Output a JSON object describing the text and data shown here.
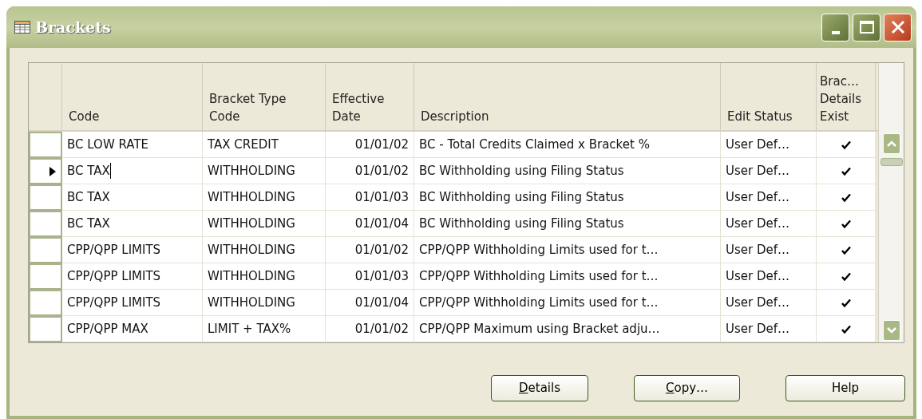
{
  "window": {
    "title": "Brackets"
  },
  "table": {
    "columns": [
      "Code",
      "Bracket Type Code",
      "Effective Date",
      "Description",
      "Edit Status",
      "Brac… Details Exist"
    ],
    "rows": [
      {
        "code": "BC LOW RATE",
        "bracket_type_code": "TAX CREDIT",
        "effective_date": "01/01/02",
        "description": "BC - Total Credits Claimed x Bracket %",
        "edit_status": "User Def…",
        "details_exist": true,
        "selected": false
      },
      {
        "code": "BC TAX",
        "bracket_type_code": "WITHHOLDING",
        "effective_date": "01/01/02",
        "description": "BC Withholding using Filing Status",
        "edit_status": "User Def…",
        "details_exist": true,
        "selected": true
      },
      {
        "code": "BC TAX",
        "bracket_type_code": "WITHHOLDING",
        "effective_date": "01/01/03",
        "description": "BC Withholding using Filing Status",
        "edit_status": "User Def…",
        "details_exist": true,
        "selected": false
      },
      {
        "code": "BC TAX",
        "bracket_type_code": "WITHHOLDING",
        "effective_date": "01/01/04",
        "description": "BC Withholding using Filing Status",
        "edit_status": "User Def…",
        "details_exist": true,
        "selected": false
      },
      {
        "code": "CPP/QPP LIMITS",
        "bracket_type_code": "WITHHOLDING",
        "effective_date": "01/01/02",
        "description": "CPP/QPP Withholding Limits used for t…",
        "edit_status": "User Def…",
        "details_exist": true,
        "selected": false
      },
      {
        "code": "CPP/QPP LIMITS",
        "bracket_type_code": "WITHHOLDING",
        "effective_date": "01/01/03",
        "description": "CPP/QPP Withholding Limits used for t…",
        "edit_status": "User Def…",
        "details_exist": true,
        "selected": false
      },
      {
        "code": "CPP/QPP LIMITS",
        "bracket_type_code": "WITHHOLDING",
        "effective_date": "01/01/04",
        "description": "CPP/QPP Withholding Limits used for t…",
        "edit_status": "User Def…",
        "details_exist": true,
        "selected": false
      },
      {
        "code": "CPP/QPP MAX",
        "bracket_type_code": "LIMIT + TAX%",
        "effective_date": "01/01/02",
        "description": "CPP/QPP Maximum using Bracket adju…",
        "edit_status": "User Def…",
        "details_exist": true,
        "selected": false
      }
    ]
  },
  "buttons": [
    {
      "label": "Details",
      "mnemonic": true
    },
    {
      "label": "Copy…",
      "mnemonic": true
    },
    {
      "label": "Help",
      "mnemonic": false
    }
  ]
}
